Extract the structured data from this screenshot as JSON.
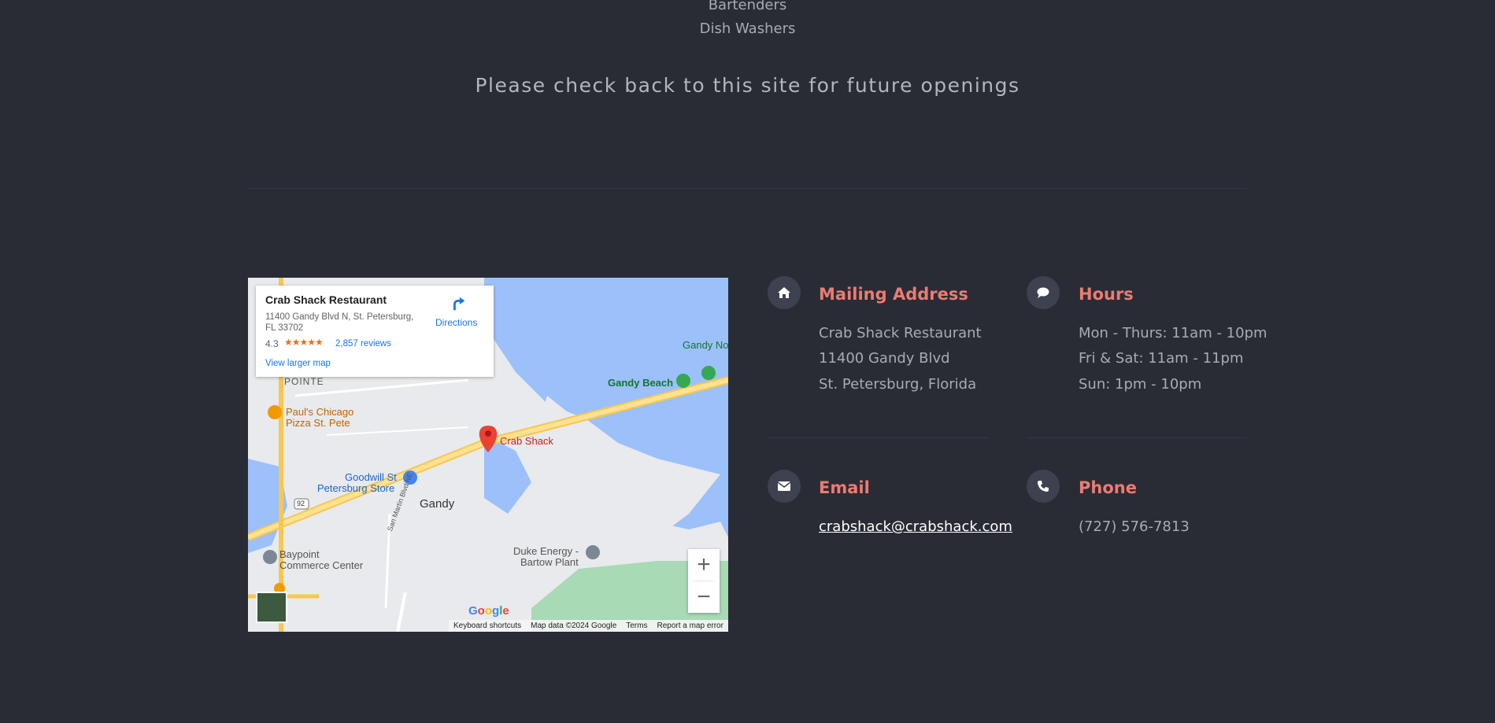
{
  "jobs": [
    "Bartenders",
    "Dish Washers"
  ],
  "check_back_text": "Please check back to this site for future openings",
  "map": {
    "card": {
      "name": "Crab Shack Restaurant",
      "address": "11400 Gandy Blvd N, St. Petersburg, FL 33702",
      "rating": "4.3",
      "stars": "★★★★★",
      "reviews": "2,857 reviews",
      "larger_map": "View larger map",
      "directions": "Directions"
    },
    "labels": {
      "pointe": "POINTE",
      "pauls_line1": "Paul's Chicago",
      "pauls_line2": "Pizza St. Pete",
      "crab_shack": "Crab Shack",
      "goodwill_line1": "Goodwill St",
      "goodwill_line2": "Petersburg Store",
      "gandy": "Gandy",
      "baypoint_line1": "Baypoint",
      "baypoint_line2": "Commerce Center",
      "duke_line1": "Duke Energy -",
      "duke_line2": "Bartow Plant",
      "gandy_beach": "Gandy Beach",
      "gandy_no": "Gandy No",
      "san_martin": "San Martin Blvd NE",
      "route_92": "92"
    },
    "zoom_in": "+",
    "zoom_out": "−",
    "logo": "Google",
    "footer": {
      "shortcuts": "Keyboard shortcuts",
      "map_data": "Map data ©2024 Google",
      "terms": "Terms",
      "report": "Report a map error"
    }
  },
  "mailing": {
    "title": "Mailing Address",
    "lines": [
      "Crab Shack Restaurant",
      "11400 Gandy Blvd",
      "St. Petersburg, Florida"
    ]
  },
  "hours": {
    "title": "Hours",
    "lines": [
      "Mon - Thurs: 11am - 10pm",
      "Fri & Sat: 11am - 11pm",
      "Sun: 1pm - 10pm"
    ]
  },
  "email": {
    "title": "Email",
    "address": "crabshack@crabshack.com"
  },
  "phone": {
    "title": "Phone",
    "number": "(727) 576-7813"
  },
  "colors": {
    "background": "#292c35",
    "accent": "#ec7b72",
    "icon_circle": "#3e4250"
  }
}
